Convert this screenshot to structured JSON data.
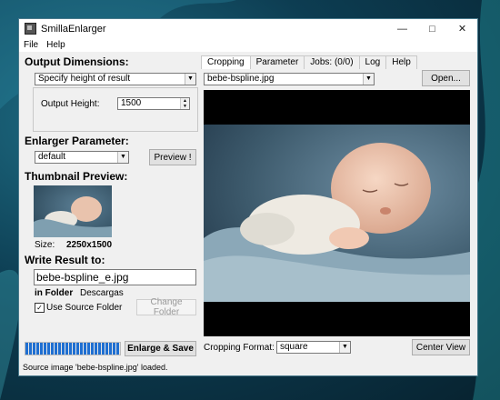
{
  "window": {
    "title": "SmillaEnlarger"
  },
  "menu": [
    "File",
    "Help"
  ],
  "output_dimensions": {
    "heading": "Output Dimensions:",
    "mode_selected": "Specify height of result",
    "height_label": "Output Height:",
    "height_value": "1500"
  },
  "enlarger": {
    "heading": "Enlarger Parameter:",
    "preset_selected": "default",
    "preview_button": "Preview !"
  },
  "thumbnail": {
    "heading": "Thumbnail Preview:",
    "size_label": "Size:",
    "size_value": "2250x1500"
  },
  "write_result": {
    "heading": "Write Result to:",
    "filename": "bebe-bspline_e.jpg",
    "folder_label": "in Folder",
    "folder_value": "Descargas",
    "use_source_label": "Use Source Folder",
    "use_source_checked": true,
    "change_folder_button": "Change Folder"
  },
  "progress": {
    "value": 1.0
  },
  "enlarge_button": "Enlarge & Save",
  "status_text": "Source image 'bebe-bspline.jpg' loaded.",
  "tabs": [
    "Cropping",
    "Parameter",
    "Jobs: (0/0)",
    "Log",
    "Help"
  ],
  "active_tab": "Cropping",
  "source_file": "bebe-bspline.jpg",
  "open_button": "Open...",
  "cropping_format_label": "Cropping Format:",
  "cropping_format_value": "square",
  "center_view_button": "Center View",
  "colors": {
    "accent": "#1f6fd1",
    "window_bg": "#f0f0f0"
  }
}
